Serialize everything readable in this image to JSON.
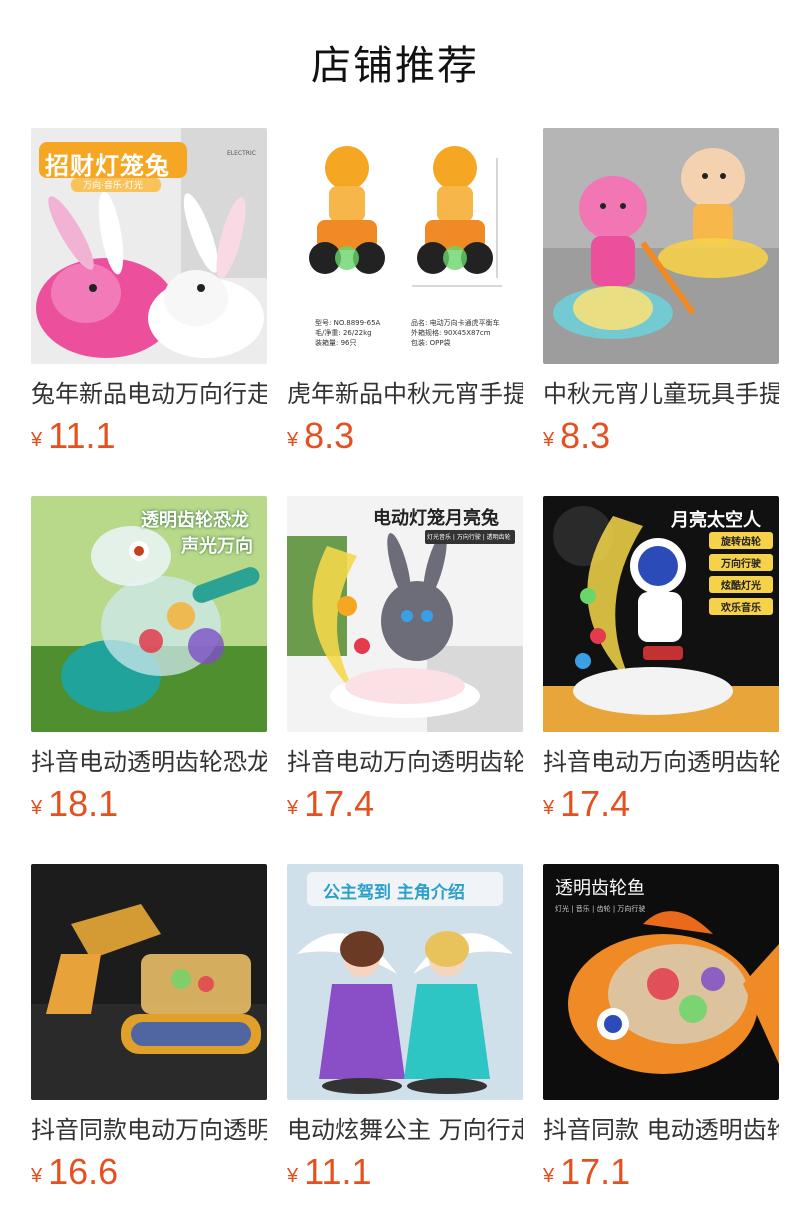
{
  "title": "店铺推荐",
  "currency_symbol": "¥",
  "products": [
    {
      "name": "兔年新品电动万向行走",
      "price": "11.1",
      "image_text": "招财灯笼兔",
      "image_subtext": "万向·音乐·灯光",
      "image_corner": "ELECTRIC"
    },
    {
      "name": "虎年新品中秋元宵手提",
      "price": "8.3",
      "image_text_lines": [
        "型号: NO.8899-65A",
        "毛/净重: 26/22kg",
        "装箱量: 96只",
        "品名: 电动万向卡通虎平衡车",
        "外箱规格: 90X45X87cm",
        "包装: OPP袋"
      ]
    },
    {
      "name": "中秋元宵儿童玩具手提",
      "price": "8.3"
    },
    {
      "name": "抖音电动透明齿轮恐龙",
      "price": "18.1",
      "image_text": "透明齿轮恐龙",
      "image_subtext": "声光万向"
    },
    {
      "name": "抖音电动万向透明齿轮",
      "price": "17.4",
      "image_text": "电动灯笼月亮兔",
      "image_subtext": "灯光音乐 | 万向行驶 | 透明齿轮"
    },
    {
      "name": "抖音电动万向透明齿轮",
      "price": "17.4",
      "image_text": "月亮太空人",
      "image_tags": [
        "旋转齿轮",
        "万向行驶",
        "炫酷灯光",
        "欢乐音乐"
      ]
    },
    {
      "name": "抖音同款电动万向透明",
      "price": "16.6"
    },
    {
      "name": "电动炫舞公主 万向行走",
      "price": "11.1",
      "image_text": "公主驾到 主角介绍"
    },
    {
      "name": "抖音同款 电动透明齿轮",
      "price": "17.1",
      "image_text": "透明齿轮鱼",
      "image_subtext": "灯光 | 音乐 | 齿轮 | 万向行驶"
    }
  ],
  "colors": {
    "price": "#e4501f",
    "title": "#111111",
    "name": "#333333"
  }
}
